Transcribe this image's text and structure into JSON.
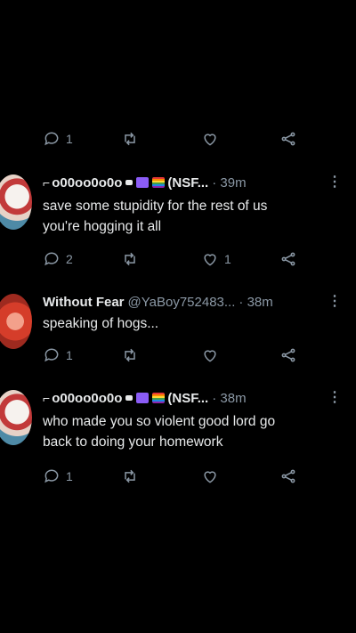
{
  "top_actions": {
    "reply_count": "1"
  },
  "tweets": [
    {
      "name": "o00oo0o0o",
      "handle": "(NSF...",
      "time": "· 39m",
      "text_line1": "save some stupidity for the rest of us",
      "text_line2": "you're hogging it all",
      "reply_count": "2",
      "like_count": "1"
    },
    {
      "name": "Without Fear",
      "handle": "@YaBoy752483...",
      "time": "· 38m",
      "text_line1": "speaking of hogs...",
      "reply_count": "1"
    },
    {
      "name": "o00oo0o0o",
      "handle": "(NSF...",
      "time": "· 38m",
      "text_line1": "who made you so violent good lord go",
      "text_line2": "back to doing your homework",
      "reply_count": "1"
    }
  ],
  "colors": {
    "background": "#000000",
    "text": "#e7e9ea",
    "muted": "#8b98a5"
  },
  "icons": [
    "reply-icon",
    "retweet-icon",
    "like-icon",
    "share-icon",
    "more-icon",
    "shark-icon"
  ]
}
